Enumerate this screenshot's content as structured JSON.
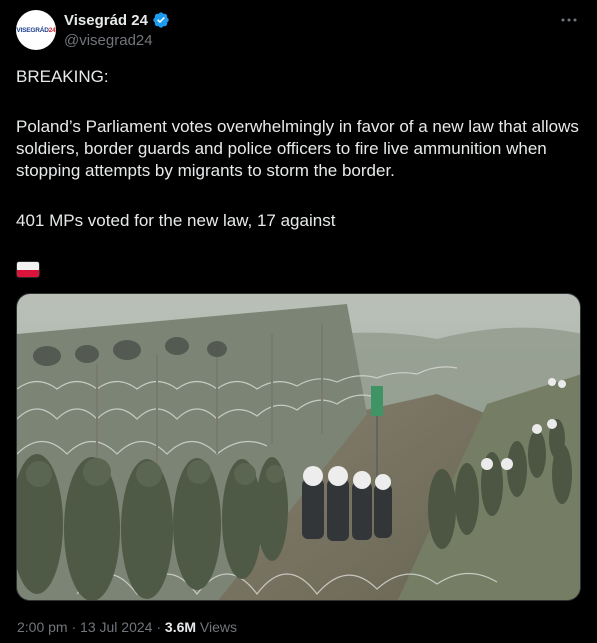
{
  "tweet": {
    "avatar_text_blue": "VISEGRÁD",
    "avatar_text_red": "24",
    "display_name": "Visegrád 24",
    "handle": "@visegrad24",
    "verified_icon": "verified-badge-icon",
    "more_icon": "more-horizontal-icon",
    "text_breaking": "BREAKING:",
    "text_main": "Poland’s Parliament votes overwhelmingly in favor of a new law that allows soldiers, border guards and police officers to fire live ammunition when stopping attempts by migrants to storm the border.",
    "text_votes": "401 MPs voted for the new law, 17 against",
    "flag_emoji": "poland-flag-icon",
    "time": "2:00 pm",
    "date": "13 Jul 2024",
    "separator": "·",
    "views_count": "3.6M",
    "views_label": "Views"
  },
  "colors": {
    "background": "#000000",
    "text": "#e7e9ea",
    "muted": "#71767b",
    "verified_blue": "#1d9bf0"
  }
}
